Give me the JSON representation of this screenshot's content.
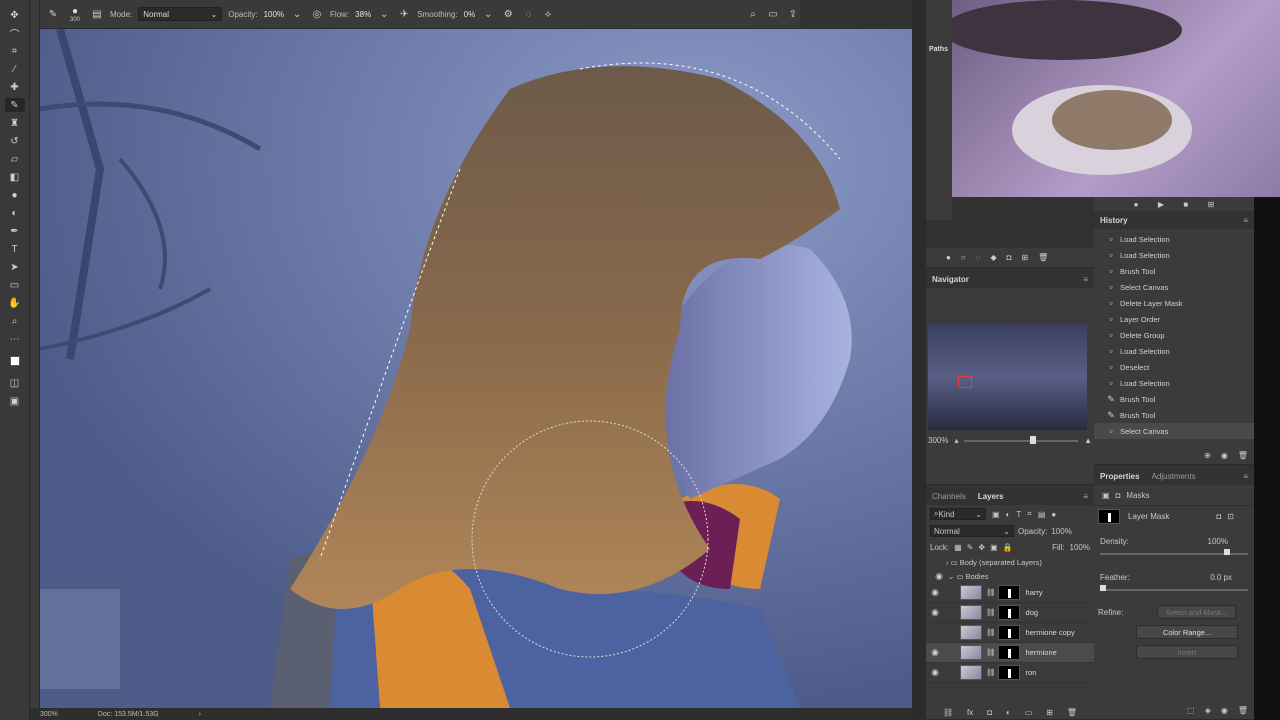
{
  "options_bar": {
    "brush_size": "300",
    "mode_label": "Mode:",
    "mode_value": "Normal",
    "opacity_label": "Opacity:",
    "opacity_value": "100%",
    "flow_label": "Flow:",
    "flow_value": "38%",
    "smoothing_label": "Smoothing:",
    "smoothing_value": "0%"
  },
  "toolbar": {
    "tools": [
      "move-icon",
      "lasso-icon",
      "crop-icon",
      "eyedropper-icon",
      "healing-icon",
      "brush-icon",
      "stamp-icon",
      "history-brush-icon",
      "eraser-icon",
      "gradient-icon",
      "blur-icon",
      "dodge-icon",
      "pen-icon",
      "type-icon",
      "path-select-icon",
      "rectangle-icon",
      "hand-icon",
      "zoom-icon",
      "more-icon"
    ]
  },
  "status": {
    "zoom": "300%",
    "doc": "Doc: 153.5M/1.53G"
  },
  "paths_tab": "Paths",
  "history": {
    "title": "History",
    "items": [
      {
        "label": "Load Selection",
        "icon": "snapshot-icon"
      },
      {
        "label": "Load Selection",
        "icon": "snapshot-icon"
      },
      {
        "label": "Brush Tool",
        "icon": "snapshot-icon"
      },
      {
        "label": "Select Canvas",
        "icon": "snapshot-icon"
      },
      {
        "label": "Delete Layer Mask",
        "icon": "snapshot-icon"
      },
      {
        "label": "Layer Order",
        "icon": "snapshot-icon"
      },
      {
        "label": "Delete Group",
        "icon": "snapshot-icon"
      },
      {
        "label": "Load Selection",
        "icon": "snapshot-icon"
      },
      {
        "label": "Deselect",
        "icon": "snapshot-icon"
      },
      {
        "label": "Load Selection",
        "icon": "snapshot-icon"
      },
      {
        "label": "Brush Tool",
        "icon": "brush-icon"
      },
      {
        "label": "Brush Tool",
        "icon": "brush-icon"
      },
      {
        "label": "Select Canvas",
        "icon": "snapshot-icon"
      }
    ],
    "selected_index": 12
  },
  "navigator": {
    "title": "Navigator",
    "zoom": "300%"
  },
  "layers_panel": {
    "tab_channels": "Channels",
    "tab_layers": "Layers",
    "filter_kind": "Kind",
    "blend_mode": "Normal",
    "opacity_label": "Opacity:",
    "opacity_value": "100%",
    "lock_label": "Lock:",
    "fill_label": "Fill:",
    "fill_value": "100%",
    "groups": [
      "Body (separated Layers)",
      "Bodies"
    ],
    "layers": [
      {
        "name": "harry",
        "visible": true
      },
      {
        "name": "dog",
        "visible": true
      },
      {
        "name": "hermione copy",
        "visible": false
      },
      {
        "name": "hermione",
        "visible": true
      },
      {
        "name": "ron",
        "visible": true
      }
    ],
    "selected_index": 3
  },
  "properties": {
    "tab_properties": "Properties",
    "tab_adjustments": "Adjustments",
    "masks_label": "Masks",
    "layer_mask_label": "Layer Mask",
    "density_label": "Density:",
    "density_value": "100%",
    "feather_label": "Feather:",
    "feather_value": "0.0 px",
    "refine_label": "Refine:",
    "select_and_mask": "Select and Mask...",
    "color_range": "Color Range...",
    "invert": "Invert"
  }
}
